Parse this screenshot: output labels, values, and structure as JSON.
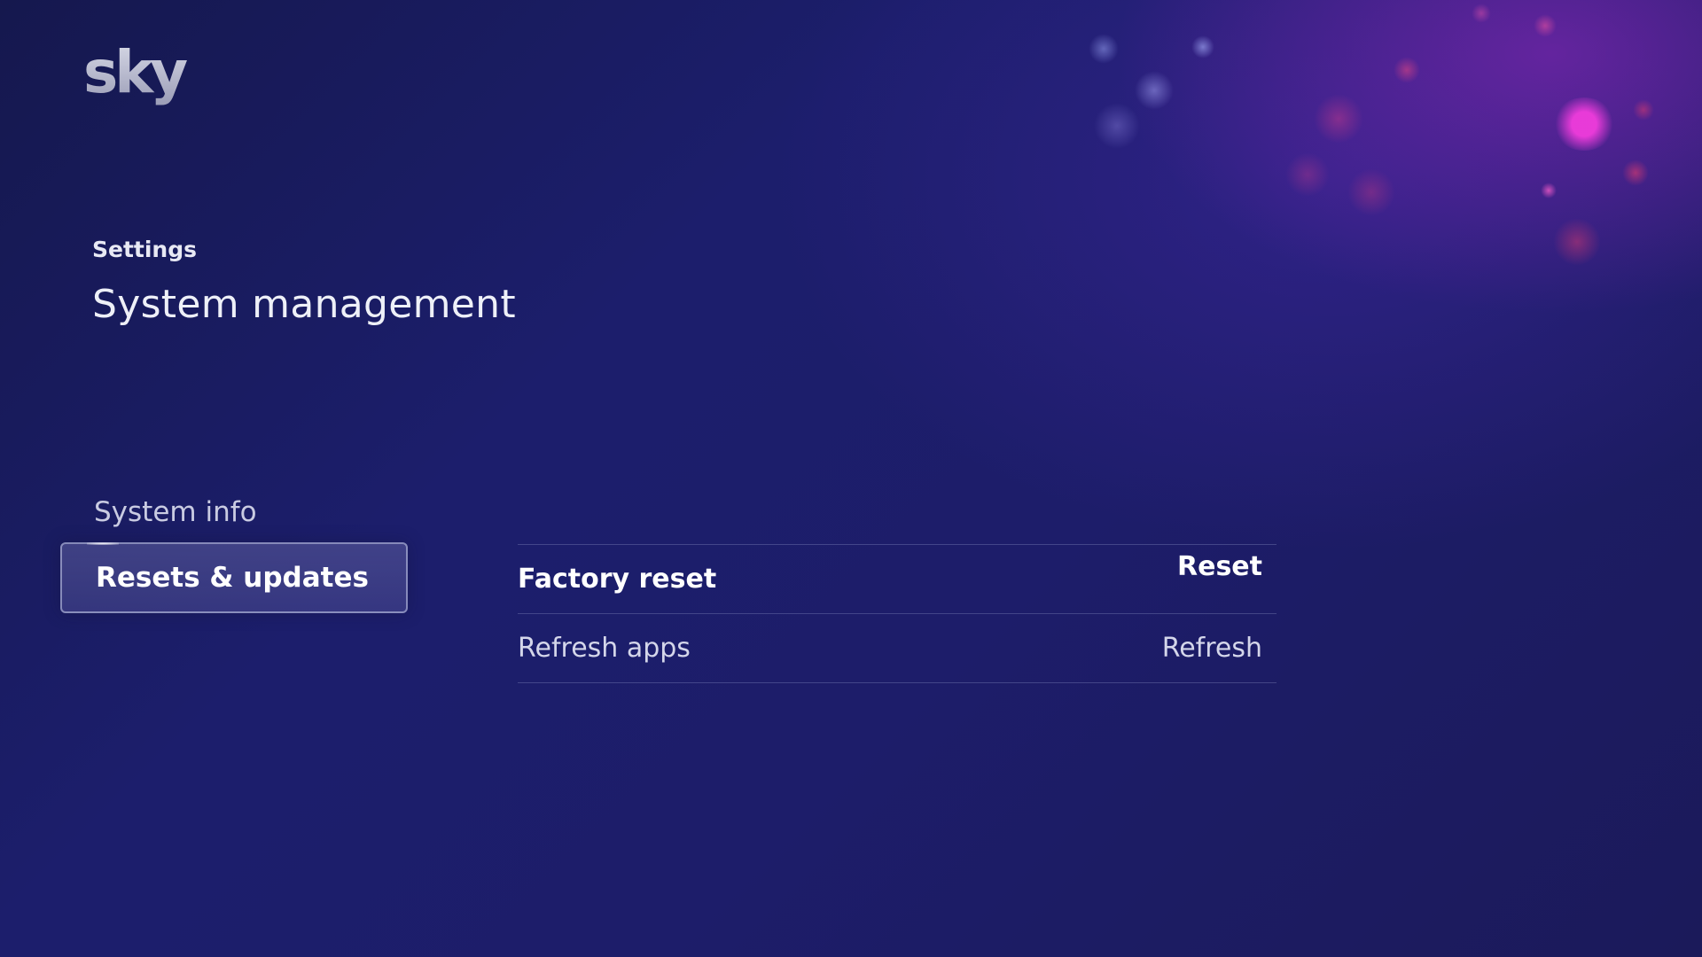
{
  "brand": {
    "logo_text": "sky",
    "logo_icon": "sky-logo-icon"
  },
  "header": {
    "breadcrumb": "Settings",
    "title": "System management"
  },
  "nav": {
    "items": [
      {
        "label": "System info",
        "selected": false
      },
      {
        "label": "Resets & updates",
        "selected": true
      }
    ]
  },
  "options": [
    {
      "label": "Factory reset",
      "action": "Reset",
      "focused": true
    },
    {
      "label": "Refresh apps",
      "action": "Refresh",
      "focused": false
    }
  ],
  "colors": {
    "background": "#1c1e6c",
    "accent_pink": "#e23bd2",
    "text": "#ffffff",
    "text_dim": "#c9cbe2"
  }
}
